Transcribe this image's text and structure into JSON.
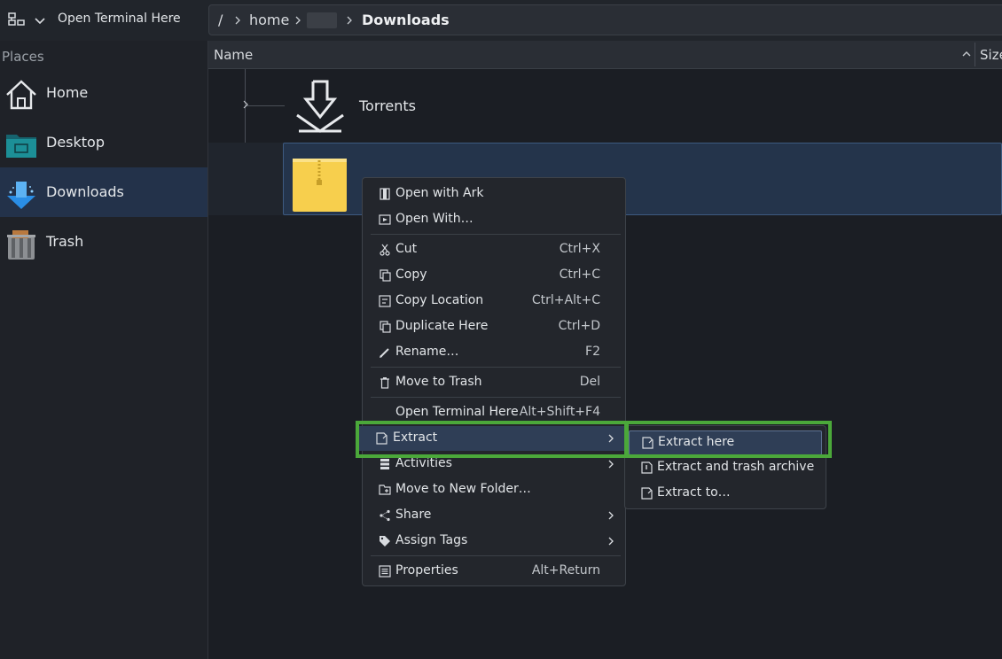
{
  "toolbar": {
    "open_terminal_label": "Open Terminal Here",
    "breadcrumb": [
      "/",
      "home",
      "Downloads"
    ]
  },
  "sidebar": {
    "title": "Places",
    "items": [
      {
        "label": "Home",
        "icon": "home-icon"
      },
      {
        "label": "Desktop",
        "icon": "desktop-folder-icon"
      },
      {
        "label": "Downloads",
        "icon": "downloads-folder-icon",
        "active": true
      },
      {
        "label": "Trash",
        "icon": "trash-icon"
      }
    ]
  },
  "file_view": {
    "columns": [
      "Name",
      "Size"
    ],
    "rows": [
      {
        "name": "Torrents",
        "icon": "download-folder-icon"
      },
      {
        "name": "",
        "icon": "zip-archive-icon",
        "selected": true
      }
    ]
  },
  "context_menu": {
    "items": [
      {
        "label": "Open with Ark",
        "shortcut": "",
        "icon": "ark-icon"
      },
      {
        "label": "Open With…",
        "shortcut": "",
        "icon": "open-with-icon"
      },
      {
        "label": "Cut",
        "shortcut": "Ctrl+X",
        "icon": "scissors-icon"
      },
      {
        "label": "Copy",
        "shortcut": "Ctrl+C",
        "icon": "copy-icon"
      },
      {
        "label": "Copy Location",
        "shortcut": "Ctrl+Alt+C",
        "icon": "copy-location-icon"
      },
      {
        "label": "Duplicate Here",
        "shortcut": "Ctrl+D",
        "icon": "duplicate-icon"
      },
      {
        "label": "Rename…",
        "shortcut": "F2",
        "icon": "pencil-icon"
      },
      {
        "label": "Move to Trash",
        "shortcut": "Del",
        "icon": "trash-can-icon"
      },
      {
        "label": "Open Terminal Here",
        "shortcut": "Alt+Shift+F4",
        "icon": ""
      },
      {
        "label": "Extract",
        "shortcut": "",
        "icon": "extract-icon"
      },
      {
        "label": "Activities",
        "shortcut": "",
        "icon": "activities-icon"
      },
      {
        "label": "Move to New Folder…",
        "shortcut": "",
        "icon": "new-folder-icon"
      },
      {
        "label": "Share",
        "shortcut": "",
        "icon": "share-icon"
      },
      {
        "label": "Assign Tags",
        "shortcut": "",
        "icon": "tag-icon"
      },
      {
        "label": "Properties",
        "shortcut": "Alt+Return",
        "icon": "properties-icon"
      }
    ]
  },
  "extract_submenu": {
    "items": [
      {
        "label": "Extract here",
        "icon": "extract-icon"
      },
      {
        "label": "Extract and trash archive",
        "icon": "extract-trash-icon"
      },
      {
        "label": "Extract to…",
        "icon": "extract-to-icon"
      }
    ]
  },
  "colors": {
    "accent": "#3d5a80",
    "highlight": "#4ba83a",
    "menu_bg": "#23262c",
    "selection": "#24344b"
  }
}
